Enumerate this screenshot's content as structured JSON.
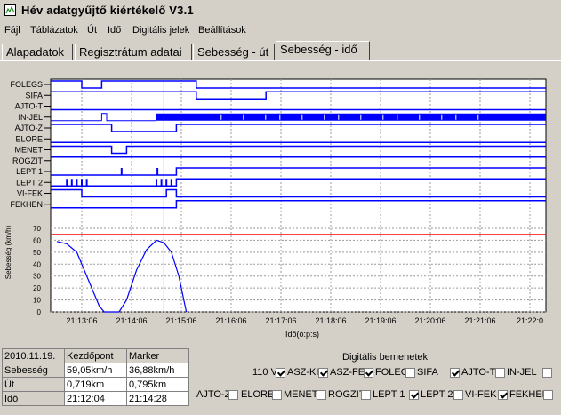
{
  "window": {
    "title": "Hév adatgyűjtő kiértékelő  V3.1"
  },
  "menu": [
    "Fájl",
    "Táblázatok",
    "Út",
    "Idő",
    "Digitális jelek",
    "Beállítások"
  ],
  "tabs": [
    "Alapadatok",
    "Regisztrátum adatai",
    "Sebesség - út",
    "Sebesség - idő"
  ],
  "active_tab": "Sebesség - idő",
  "colors": {
    "signal": "#0000ff",
    "limit": "#ff0000",
    "marker": "#ff0000",
    "curve": "#0000ff"
  },
  "chart_data": {
    "type": "line",
    "signals": [
      {
        "name": "FOLEGS",
        "segments": [
          [
            0,
            1
          ],
          [
            0.5,
            1
          ],
          [
            0.5,
            0
          ],
          [
            0.9,
            0
          ],
          [
            0.9,
            1
          ],
          [
            2.8,
            1
          ],
          [
            2.8,
            0
          ],
          [
            10,
            0
          ]
        ]
      },
      {
        "name": "SIFA",
        "segments": [
          [
            0,
            1
          ],
          [
            2.8,
            1
          ],
          [
            2.8,
            0
          ],
          [
            4.2,
            0
          ],
          [
            4.2,
            1
          ],
          [
            10,
            1
          ]
        ]
      },
      {
        "name": "AJTO-T",
        "segments": [
          [
            0,
            0
          ],
          [
            10,
            0
          ]
        ]
      },
      {
        "name": "IN-JEL",
        "dense_from": 2.0
      },
      {
        "name": "AJTO-Z",
        "segments": [
          [
            0,
            1
          ],
          [
            1.1,
            1
          ],
          [
            1.1,
            0
          ],
          [
            2.4,
            0
          ],
          [
            2.4,
            1
          ],
          [
            10,
            1
          ]
        ]
      },
      {
        "name": "ELORE",
        "segments": [
          [
            0,
            0
          ],
          [
            10,
            0
          ]
        ]
      },
      {
        "name": "MENET",
        "segments": [
          [
            0,
            1
          ],
          [
            1.1,
            1
          ],
          [
            1.1,
            0
          ],
          [
            1.4,
            0
          ],
          [
            1.4,
            1
          ],
          [
            10,
            1
          ]
        ]
      },
      {
        "name": "ROGZIT",
        "segments": [
          [
            0,
            1
          ],
          [
            10,
            1
          ]
        ]
      },
      {
        "name": "LEPT 1",
        "segments": [
          [
            0,
            0
          ],
          [
            2.4,
            0
          ],
          [
            2.4,
            1
          ],
          [
            10,
            1
          ]
        ]
      },
      {
        "name": "LEPT 2",
        "segments": [
          [
            0,
            0
          ],
          [
            2.4,
            0
          ],
          [
            2.4,
            1
          ],
          [
            10,
            1
          ]
        ]
      },
      {
        "name": "VI-FEK",
        "segments": [
          [
            0,
            1
          ],
          [
            0.5,
            1
          ],
          [
            0.5,
            0
          ],
          [
            2.2,
            0
          ],
          [
            2.2,
            1
          ],
          [
            2.4,
            1
          ],
          [
            2.4,
            0
          ],
          [
            10,
            0
          ]
        ]
      },
      {
        "name": "FEKHEN",
        "segments": [
          [
            0,
            0
          ],
          [
            2.4,
            0
          ],
          [
            2.4,
            1
          ],
          [
            10,
            1
          ]
        ]
      }
    ],
    "x_ticks": [
      "21:13:06",
      "21:14:06",
      "21:15:06",
      "21:16:06",
      "21:17:06",
      "21:18:06",
      "21:19:06",
      "21:20:06",
      "21:21:06",
      "21:22:0"
    ],
    "xlabel": "Idő(ó:p:s)",
    "ylabel": "Sebesség (km/h)",
    "y_ticks": [
      0,
      10,
      20,
      30,
      40,
      50,
      60,
      70
    ],
    "ylim": [
      0,
      70
    ],
    "speed_limit": 65,
    "marker_x": 2.15,
    "speed_curve": [
      [
        0,
        59
      ],
      [
        0.2,
        57
      ],
      [
        0.4,
        50
      ],
      [
        0.55,
        35
      ],
      [
        0.7,
        20
      ],
      [
        0.85,
        5
      ],
      [
        0.95,
        0
      ],
      [
        1.25,
        0
      ],
      [
        1.4,
        10
      ],
      [
        1.6,
        35
      ],
      [
        1.8,
        52
      ],
      [
        2.0,
        60
      ],
      [
        2.15,
        58
      ],
      [
        2.3,
        50
      ],
      [
        2.45,
        30
      ],
      [
        2.55,
        10
      ],
      [
        2.6,
        0
      ]
    ]
  },
  "info": {
    "date": "2010.11.19.",
    "col1": "Kezdőpont",
    "col2": "Marker",
    "rows": [
      {
        "label": "Sebesség",
        "start": "59,05km/h",
        "marker": "36,88km/h"
      },
      {
        "label": "Út",
        "start": "0,719km",
        "marker": "0,795km"
      },
      {
        "label": "Idő",
        "start": "21:12:04",
        "marker": "21:14:28"
      }
    ]
  },
  "digital": {
    "title": "Digitális bemenetek",
    "voltage": "110 V",
    "row1": [
      {
        "label": "ASZ-KI",
        "checked": true
      },
      {
        "label": "ASZ-FE",
        "checked": true
      },
      {
        "label": "FOLEGS",
        "checked": true
      },
      {
        "label": "SIFA",
        "checked": false
      },
      {
        "label": "AJTO-T",
        "checked": true
      },
      {
        "label": "IN-JEL",
        "checked": false
      },
      {
        "label": "",
        "checked": false
      }
    ],
    "row2": [
      {
        "label": "AJTO-Z",
        "checked": false
      },
      {
        "label": "ELORE",
        "checked": false
      },
      {
        "label": "MENET",
        "checked": false
      },
      {
        "label": "ROGZIT",
        "checked": false
      },
      {
        "label": "LEPT 1",
        "checked": true
      },
      {
        "label": "LEPT 2",
        "checked": false
      },
      {
        "label": "VI-FEK",
        "checked": true
      },
      {
        "label": "FEKHEN",
        "checked": false
      }
    ]
  }
}
